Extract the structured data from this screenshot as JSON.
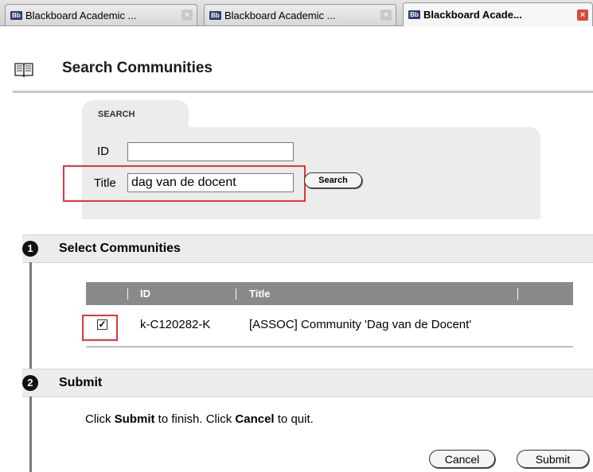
{
  "browser": {
    "tabs": [
      {
        "favicon": "Bb",
        "label": "Blackboard Academic ...",
        "active": false
      },
      {
        "favicon": "Bb",
        "label": "Blackboard Academic ...",
        "active": false
      },
      {
        "favicon": "Bb",
        "label": "Blackboard Acade...",
        "active": true
      }
    ],
    "close_glyph": "×"
  },
  "page": {
    "icon": "open-book-icon",
    "title": "Search Communities"
  },
  "search": {
    "tab_label": "SEARCH",
    "id_label": "ID",
    "id_value": "",
    "title_label": "Title",
    "title_value": "dag van de docent",
    "button_label": "Search"
  },
  "step1": {
    "number": "1",
    "title": "Select Communities",
    "table": {
      "columns": [
        "ID",
        "Title"
      ],
      "rows": [
        {
          "checked": true,
          "check_glyph": "✓",
          "id": "k-C120282-K",
          "title": "[ASSOC] Community 'Dag van de Docent'"
        }
      ]
    }
  },
  "step2": {
    "number": "2",
    "title": "Submit",
    "instruction_parts": [
      "Click ",
      "Submit",
      " to finish. Click ",
      "Cancel",
      " to quit."
    ],
    "cancel_label": "Cancel",
    "submit_label": "Submit"
  },
  "colors": {
    "highlight": "#e4343a",
    "step_band": "#ececec",
    "table_header": "#8a8a8a"
  }
}
